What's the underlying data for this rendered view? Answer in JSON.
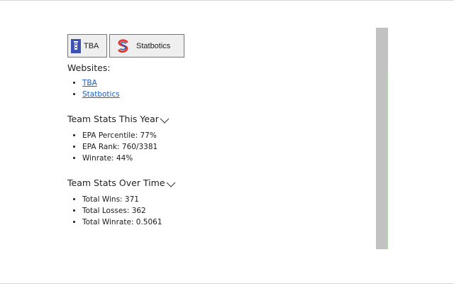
{
  "buttons": {
    "tba_label": "TBA",
    "statbotics_label": "Statbotics"
  },
  "websites": {
    "title": "Websites:",
    "links": [
      "TBA",
      "Statbotics"
    ]
  },
  "this_year": {
    "title": "Team Stats This Year",
    "items": [
      "EPA Percentile: 77%",
      "EPA Rank: 760/3381",
      "Winrate: 44%"
    ]
  },
  "over_time": {
    "title": "Team Stats Over Time",
    "items": [
      "Total Wins: 371",
      "Total Losses: 362",
      "Total Winrate: 0.5061"
    ]
  },
  "colors": {
    "link": "#1a5fc4",
    "tba_icon": "#3f51b5",
    "statbotics_icon_red": "#e53935",
    "statbotics_icon_blue": "#1e5bb8",
    "scrollbar": "#c2c2c2"
  },
  "icons": {
    "tba": "tba-logo-icon",
    "statbotics": "statbotics-logo-icon",
    "expand": "chevron-down-icon"
  }
}
